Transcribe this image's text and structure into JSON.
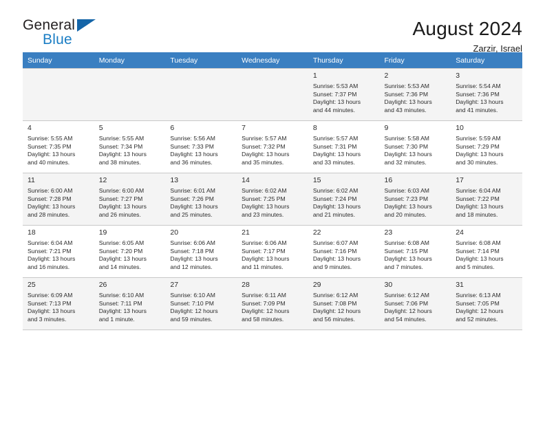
{
  "brand": {
    "line1": "General",
    "line2": "Blue",
    "triangle_color": "#1565a8",
    "blue_text_color": "#1a7dc4"
  },
  "header": {
    "title": "August 2024",
    "subtitle": "Zarzir, Israel"
  },
  "theme": {
    "header_row_bg": "#3a7fc1",
    "header_row_text": "#ffffff",
    "shaded_row_bg": "#f4f4f4",
    "grid_line": "#c8c8c8"
  },
  "weekday_headers": [
    "Sunday",
    "Monday",
    "Tuesday",
    "Wednesday",
    "Thursday",
    "Friday",
    "Saturday"
  ],
  "weeks": [
    [
      {
        "day": "",
        "sunrise": "",
        "sunset": "",
        "daylight_line1": "",
        "daylight_line2": "",
        "empty": true
      },
      {
        "day": "",
        "sunrise": "",
        "sunset": "",
        "daylight_line1": "",
        "daylight_line2": "",
        "empty": true
      },
      {
        "day": "",
        "sunrise": "",
        "sunset": "",
        "daylight_line1": "",
        "daylight_line2": "",
        "empty": true
      },
      {
        "day": "",
        "sunrise": "",
        "sunset": "",
        "daylight_line1": "",
        "daylight_line2": "",
        "empty": true
      },
      {
        "day": "1",
        "sunrise": "Sunrise: 5:53 AM",
        "sunset": "Sunset: 7:37 PM",
        "daylight_line1": "Daylight: 13 hours",
        "daylight_line2": "and 44 minutes.",
        "empty": false
      },
      {
        "day": "2",
        "sunrise": "Sunrise: 5:53 AM",
        "sunset": "Sunset: 7:36 PM",
        "daylight_line1": "Daylight: 13 hours",
        "daylight_line2": "and 43 minutes.",
        "empty": false
      },
      {
        "day": "3",
        "sunrise": "Sunrise: 5:54 AM",
        "sunset": "Sunset: 7:36 PM",
        "daylight_line1": "Daylight: 13 hours",
        "daylight_line2": "and 41 minutes.",
        "empty": false
      }
    ],
    [
      {
        "day": "4",
        "sunrise": "Sunrise: 5:55 AM",
        "sunset": "Sunset: 7:35 PM",
        "daylight_line1": "Daylight: 13 hours",
        "daylight_line2": "and 40 minutes.",
        "empty": false
      },
      {
        "day": "5",
        "sunrise": "Sunrise: 5:55 AM",
        "sunset": "Sunset: 7:34 PM",
        "daylight_line1": "Daylight: 13 hours",
        "daylight_line2": "and 38 minutes.",
        "empty": false
      },
      {
        "day": "6",
        "sunrise": "Sunrise: 5:56 AM",
        "sunset": "Sunset: 7:33 PM",
        "daylight_line1": "Daylight: 13 hours",
        "daylight_line2": "and 36 minutes.",
        "empty": false
      },
      {
        "day": "7",
        "sunrise": "Sunrise: 5:57 AM",
        "sunset": "Sunset: 7:32 PM",
        "daylight_line1": "Daylight: 13 hours",
        "daylight_line2": "and 35 minutes.",
        "empty": false
      },
      {
        "day": "8",
        "sunrise": "Sunrise: 5:57 AM",
        "sunset": "Sunset: 7:31 PM",
        "daylight_line1": "Daylight: 13 hours",
        "daylight_line2": "and 33 minutes.",
        "empty": false
      },
      {
        "day": "9",
        "sunrise": "Sunrise: 5:58 AM",
        "sunset": "Sunset: 7:30 PM",
        "daylight_line1": "Daylight: 13 hours",
        "daylight_line2": "and 32 minutes.",
        "empty": false
      },
      {
        "day": "10",
        "sunrise": "Sunrise: 5:59 AM",
        "sunset": "Sunset: 7:29 PM",
        "daylight_line1": "Daylight: 13 hours",
        "daylight_line2": "and 30 minutes.",
        "empty": false
      }
    ],
    [
      {
        "day": "11",
        "sunrise": "Sunrise: 6:00 AM",
        "sunset": "Sunset: 7:28 PM",
        "daylight_line1": "Daylight: 13 hours",
        "daylight_line2": "and 28 minutes.",
        "empty": false
      },
      {
        "day": "12",
        "sunrise": "Sunrise: 6:00 AM",
        "sunset": "Sunset: 7:27 PM",
        "daylight_line1": "Daylight: 13 hours",
        "daylight_line2": "and 26 minutes.",
        "empty": false
      },
      {
        "day": "13",
        "sunrise": "Sunrise: 6:01 AM",
        "sunset": "Sunset: 7:26 PM",
        "daylight_line1": "Daylight: 13 hours",
        "daylight_line2": "and 25 minutes.",
        "empty": false
      },
      {
        "day": "14",
        "sunrise": "Sunrise: 6:02 AM",
        "sunset": "Sunset: 7:25 PM",
        "daylight_line1": "Daylight: 13 hours",
        "daylight_line2": "and 23 minutes.",
        "empty": false
      },
      {
        "day": "15",
        "sunrise": "Sunrise: 6:02 AM",
        "sunset": "Sunset: 7:24 PM",
        "daylight_line1": "Daylight: 13 hours",
        "daylight_line2": "and 21 minutes.",
        "empty": false
      },
      {
        "day": "16",
        "sunrise": "Sunrise: 6:03 AM",
        "sunset": "Sunset: 7:23 PM",
        "daylight_line1": "Daylight: 13 hours",
        "daylight_line2": "and 20 minutes.",
        "empty": false
      },
      {
        "day": "17",
        "sunrise": "Sunrise: 6:04 AM",
        "sunset": "Sunset: 7:22 PM",
        "daylight_line1": "Daylight: 13 hours",
        "daylight_line2": "and 18 minutes.",
        "empty": false
      }
    ],
    [
      {
        "day": "18",
        "sunrise": "Sunrise: 6:04 AM",
        "sunset": "Sunset: 7:21 PM",
        "daylight_line1": "Daylight: 13 hours",
        "daylight_line2": "and 16 minutes.",
        "empty": false
      },
      {
        "day": "19",
        "sunrise": "Sunrise: 6:05 AM",
        "sunset": "Sunset: 7:20 PM",
        "daylight_line1": "Daylight: 13 hours",
        "daylight_line2": "and 14 minutes.",
        "empty": false
      },
      {
        "day": "20",
        "sunrise": "Sunrise: 6:06 AM",
        "sunset": "Sunset: 7:18 PM",
        "daylight_line1": "Daylight: 13 hours",
        "daylight_line2": "and 12 minutes.",
        "empty": false
      },
      {
        "day": "21",
        "sunrise": "Sunrise: 6:06 AM",
        "sunset": "Sunset: 7:17 PM",
        "daylight_line1": "Daylight: 13 hours",
        "daylight_line2": "and 11 minutes.",
        "empty": false
      },
      {
        "day": "22",
        "sunrise": "Sunrise: 6:07 AM",
        "sunset": "Sunset: 7:16 PM",
        "daylight_line1": "Daylight: 13 hours",
        "daylight_line2": "and 9 minutes.",
        "empty": false
      },
      {
        "day": "23",
        "sunrise": "Sunrise: 6:08 AM",
        "sunset": "Sunset: 7:15 PM",
        "daylight_line1": "Daylight: 13 hours",
        "daylight_line2": "and 7 minutes.",
        "empty": false
      },
      {
        "day": "24",
        "sunrise": "Sunrise: 6:08 AM",
        "sunset": "Sunset: 7:14 PM",
        "daylight_line1": "Daylight: 13 hours",
        "daylight_line2": "and 5 minutes.",
        "empty": false
      }
    ],
    [
      {
        "day": "25",
        "sunrise": "Sunrise: 6:09 AM",
        "sunset": "Sunset: 7:13 PM",
        "daylight_line1": "Daylight: 13 hours",
        "daylight_line2": "and 3 minutes.",
        "empty": false
      },
      {
        "day": "26",
        "sunrise": "Sunrise: 6:10 AM",
        "sunset": "Sunset: 7:11 PM",
        "daylight_line1": "Daylight: 13 hours",
        "daylight_line2": "and 1 minute.",
        "empty": false
      },
      {
        "day": "27",
        "sunrise": "Sunrise: 6:10 AM",
        "sunset": "Sunset: 7:10 PM",
        "daylight_line1": "Daylight: 12 hours",
        "daylight_line2": "and 59 minutes.",
        "empty": false
      },
      {
        "day": "28",
        "sunrise": "Sunrise: 6:11 AM",
        "sunset": "Sunset: 7:09 PM",
        "daylight_line1": "Daylight: 12 hours",
        "daylight_line2": "and 58 minutes.",
        "empty": false
      },
      {
        "day": "29",
        "sunrise": "Sunrise: 6:12 AM",
        "sunset": "Sunset: 7:08 PM",
        "daylight_line1": "Daylight: 12 hours",
        "daylight_line2": "and 56 minutes.",
        "empty": false
      },
      {
        "day": "30",
        "sunrise": "Sunrise: 6:12 AM",
        "sunset": "Sunset: 7:06 PM",
        "daylight_line1": "Daylight: 12 hours",
        "daylight_line2": "and 54 minutes.",
        "empty": false
      },
      {
        "day": "31",
        "sunrise": "Sunrise: 6:13 AM",
        "sunset": "Sunset: 7:05 PM",
        "daylight_line1": "Daylight: 12 hours",
        "daylight_line2": "and 52 minutes.",
        "empty": false
      }
    ]
  ]
}
